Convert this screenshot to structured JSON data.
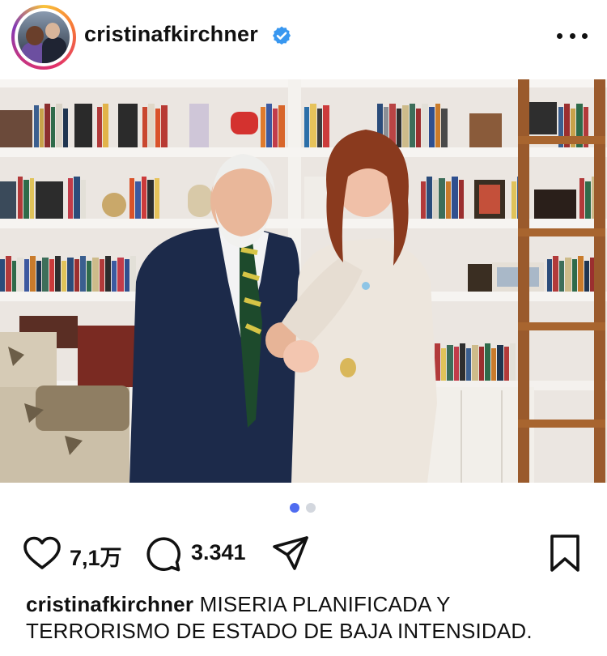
{
  "post": {
    "username": "cristinafkirchner",
    "verified": true,
    "icons": {
      "verified": "verified-badge-icon",
      "more": "more-options-icon",
      "like": "heart-icon",
      "comment": "comment-bubble-icon",
      "share": "paper-plane-icon",
      "save": "bookmark-icon"
    },
    "colors": {
      "verified_badge": "#3897f0",
      "carousel_active": "#4f6cf0",
      "carousel_inactive": "#d3d7de",
      "text": "#111111"
    },
    "carousel": {
      "total": 2,
      "current": 1
    },
    "likes": "7,1万",
    "comments": "3.341",
    "caption": {
      "username": "cristinafkirchner",
      "text": "MISERIA PLANIFICADA Y TERRORISMO DE ESTADO DE BAJA INTENSIDAD."
    }
  }
}
